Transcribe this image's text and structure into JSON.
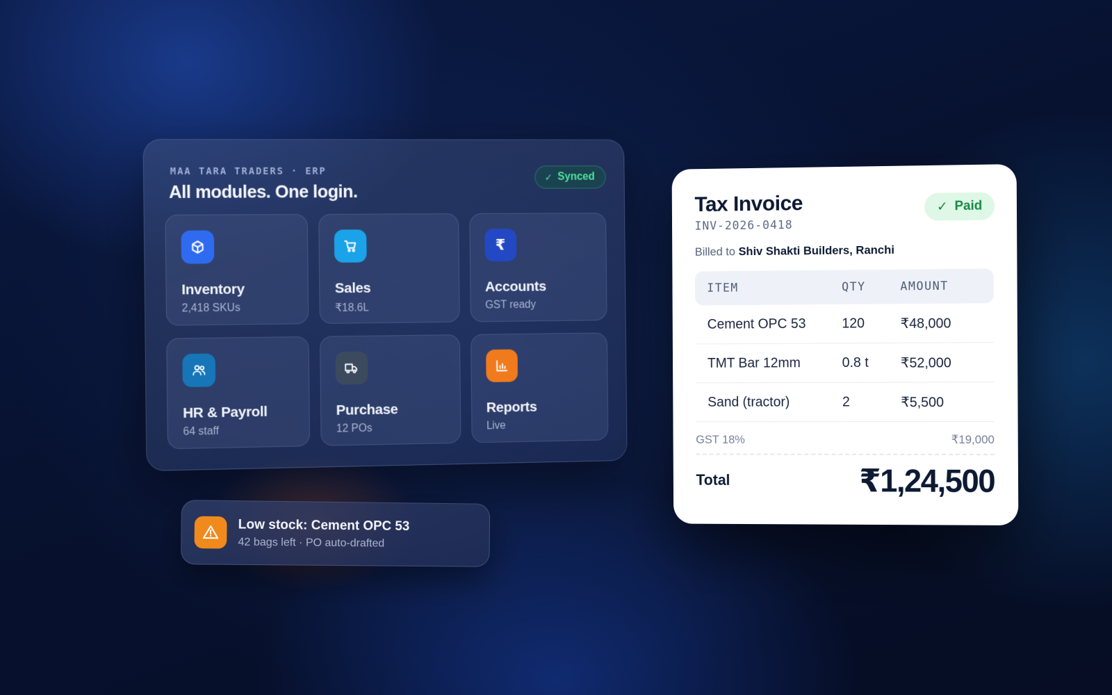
{
  "erp": {
    "eyebrow": "MAA TARA TRADERS · ERP",
    "title": "All modules. One login.",
    "status": "Synced",
    "modules": [
      {
        "name": "Inventory",
        "sub": "2,418 SKUs",
        "icon": "box-icon",
        "color": "#2f6bf0"
      },
      {
        "name": "Sales",
        "sub": "₹18.6L",
        "icon": "cart-icon",
        "color": "#1aa3e8"
      },
      {
        "name": "Accounts",
        "sub": "GST ready",
        "icon": "rupee-icon",
        "color": "#2348c4"
      },
      {
        "name": "HR & Payroll",
        "sub": "64 staff",
        "icon": "users-icon",
        "color": "#1676b8"
      },
      {
        "name": "Purchase",
        "sub": "12 POs",
        "icon": "truck-icon",
        "color": "#3c4a5e"
      },
      {
        "name": "Reports",
        "sub": "Live",
        "icon": "bar-chart-icon",
        "color": "#f07a1c"
      }
    ]
  },
  "alert": {
    "title": "Low stock: Cement OPC 53",
    "sub": "42 bags left · PO auto-drafted",
    "icon": "warning-icon",
    "color": "#f08a1c"
  },
  "invoice": {
    "title": "Tax Invoice",
    "number": "INV-2026-0418",
    "status": "Paid",
    "billed_prefix": "Billed to",
    "billed_to": "Shiv Shakti Builders, Ranchi",
    "columns": [
      "ITEM",
      "QTY",
      "AMOUNT"
    ],
    "rows": [
      {
        "item": "Cement OPC 53",
        "qty": "120",
        "amount": "₹48,000"
      },
      {
        "item": "TMT Bar 12mm",
        "qty": "0.8 t",
        "amount": "₹52,000"
      },
      {
        "item": "Sand (tractor)",
        "qty": "2",
        "amount": "₹5,500"
      }
    ],
    "gst_label": "GST 18%",
    "gst_value": "₹19,000",
    "total_label": "Total",
    "total_value": "₹1,24,500"
  }
}
